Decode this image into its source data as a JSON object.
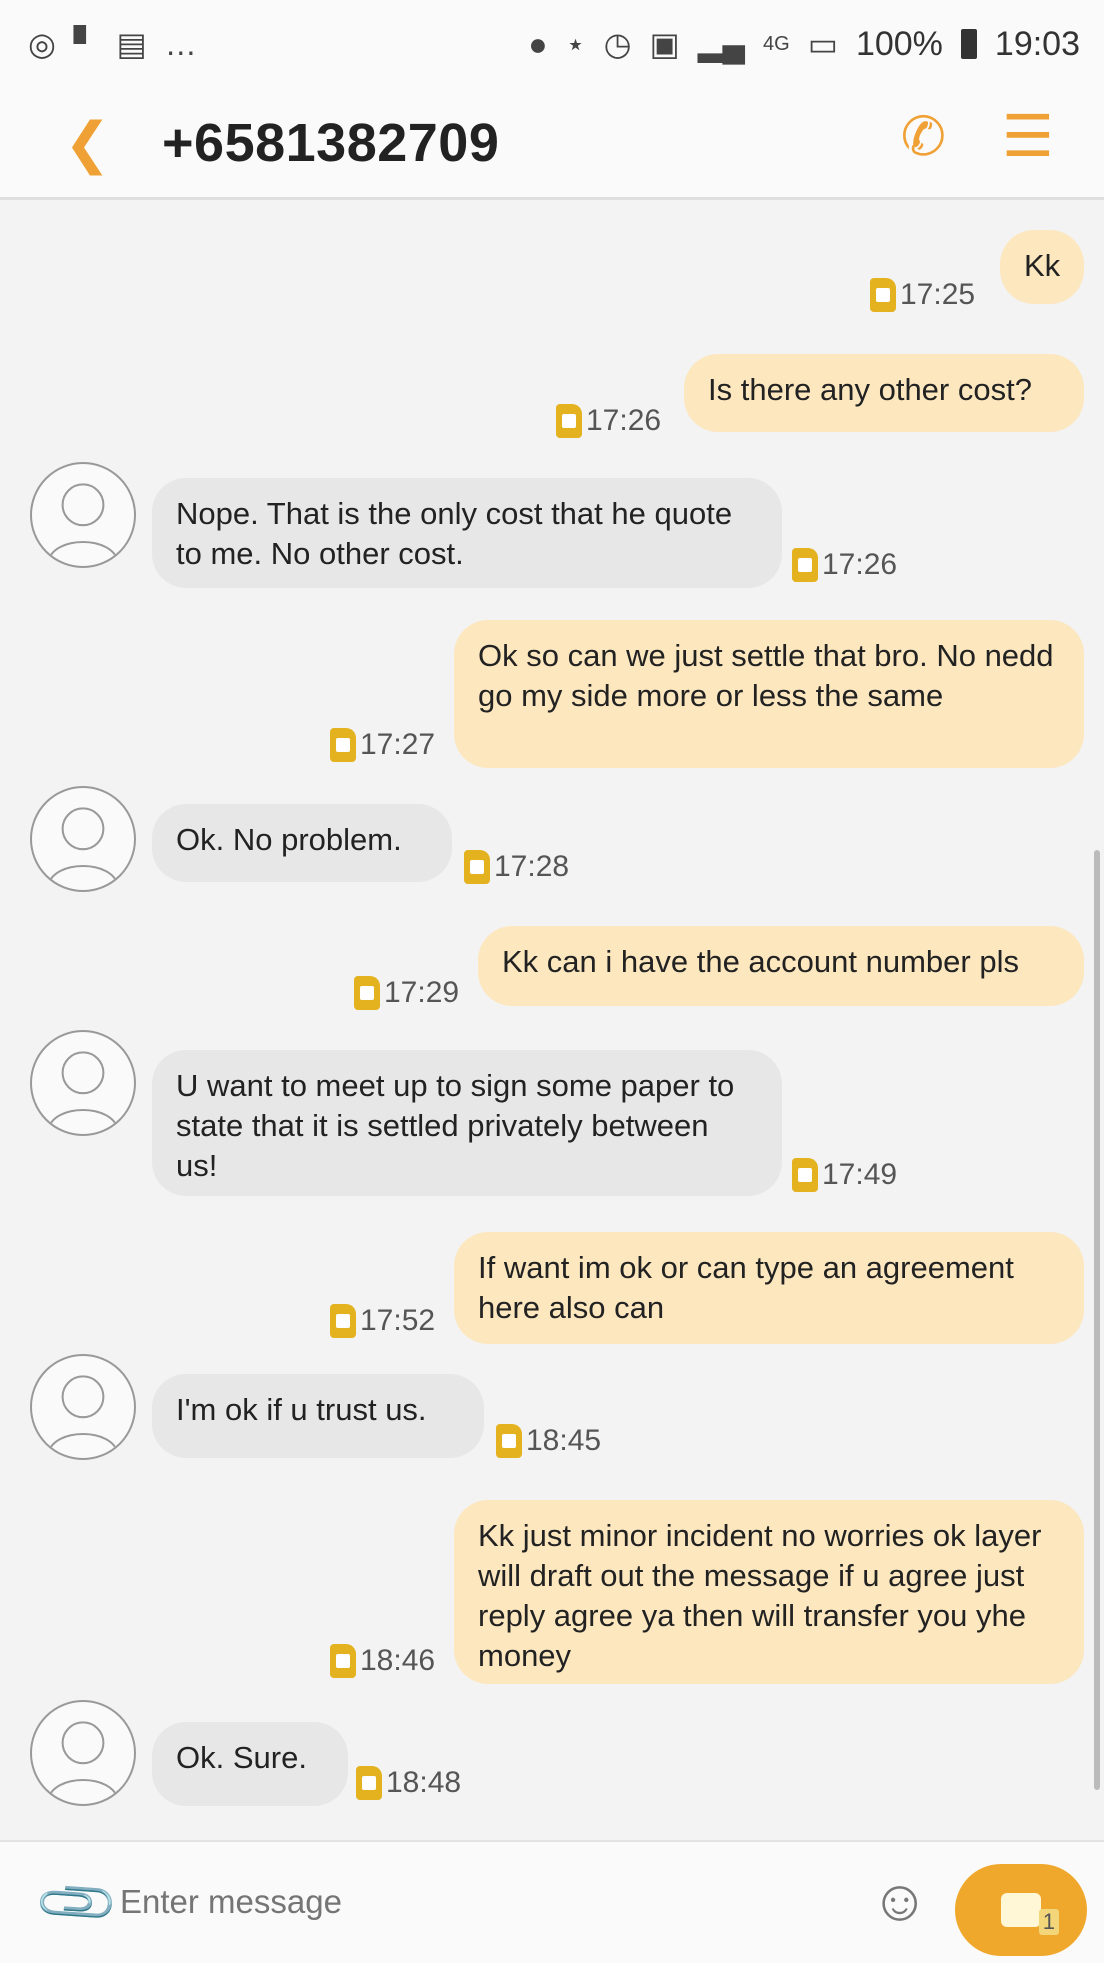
{
  "status_bar": {
    "battery": "100%",
    "time": "19:03",
    "left_icons": [
      "whatsapp-icon",
      "flipboard-icon",
      "gallery-icon",
      "more-icon"
    ],
    "right_icons": [
      "location-icon",
      "bluetooth-icon",
      "alarm-icon",
      "nfc-icon",
      "signal-icon",
      "4g-icon",
      "signal-icon-2",
      "battery-icon"
    ]
  },
  "header": {
    "title": "+6581382709",
    "back_icon": "chevron-left-icon",
    "call_icon": "phone-icon",
    "menu_icon": "menu-icon"
  },
  "messages": [
    {
      "dir": "sent",
      "text": "Kk",
      "time": "17:25"
    },
    {
      "dir": "sent",
      "text": "Is there any other cost?",
      "time": "17:26"
    },
    {
      "dir": "recv",
      "text": "Nope. That is the only cost that he quote to me. No other cost.",
      "time": "17:26"
    },
    {
      "dir": "sent",
      "text": "Ok so can we just settle that bro. No nedd go my  side more or less the same",
      "time": "17:27"
    },
    {
      "dir": "recv",
      "text": "Ok. No problem.",
      "time": "17:28"
    },
    {
      "dir": "sent",
      "text": "Kk can i have the account number pls",
      "time": "17:29"
    },
    {
      "dir": "recv",
      "text": "U want to meet up to sign some paper to state that it is settled privately between us!",
      "time": "17:49"
    },
    {
      "dir": "sent",
      "text": "If want im ok or can type an agreement here also can",
      "time": "17:52"
    },
    {
      "dir": "recv",
      "text": "I'm ok if u trust us.",
      "time": "18:45"
    },
    {
      "dir": "sent",
      "text": "Kk just minor incident no worries ok layer will draft out the message if u agree just reply agree ya then will transfer you yhe money",
      "time": "18:46"
    },
    {
      "dir": "recv",
      "text": "Ok. Sure.",
      "time": "18:48"
    }
  ],
  "composer": {
    "placeholder": "Enter message",
    "send_count": "1"
  },
  "colors": {
    "accent": "#f0a135",
    "sent_bubble": "#fce7bf",
    "received_bubble": "#e7e7e7",
    "sim_badge": "#e3b21e"
  }
}
